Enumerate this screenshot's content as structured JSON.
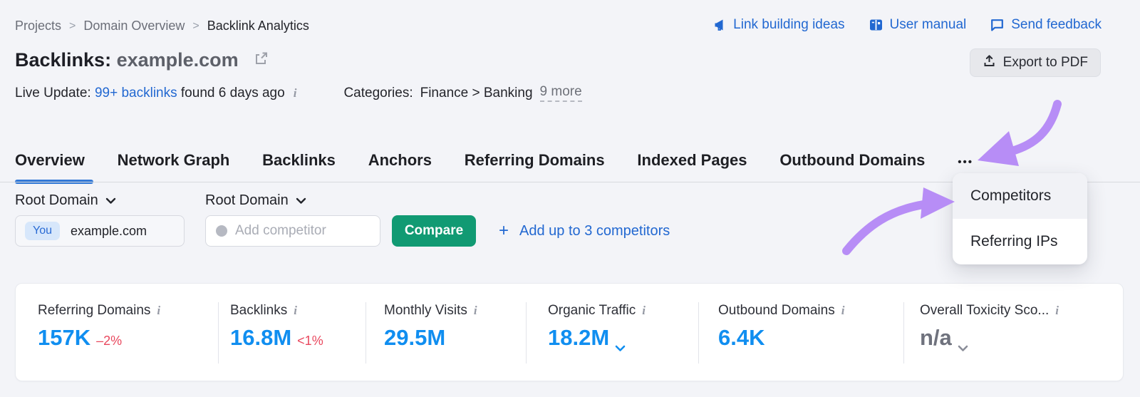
{
  "colors": {
    "page_background": "#f3f4f8",
    "link_blue": "#2268d1",
    "metric_blue": "#108ef0",
    "negative_red": "#e9485e",
    "compare_green": "#119a73",
    "arrow_purple": "#b78df6",
    "active_tab_underline": "#3178d6"
  },
  "breadcrumb": {
    "items": [
      "Projects",
      "Domain Overview",
      "Backlink Analytics"
    ],
    "separator": ">"
  },
  "header_links": {
    "link_building": "Link building ideas",
    "user_manual": "User manual",
    "send_feedback": "Send feedback"
  },
  "title": {
    "prefix": "Backlinks:",
    "domain": "example.com"
  },
  "export_button": {
    "label": "Export to PDF"
  },
  "meta": {
    "live_update_label": "Live Update:",
    "live_update_link": "99+ backlinks",
    "live_update_suffix": "found 6 days ago",
    "info_icon_glyph": "i",
    "categories_label": "Categories:",
    "categories_value": "Finance > Banking",
    "categories_more": "9 more"
  },
  "tabs": {
    "items": [
      {
        "label": "Overview",
        "active": true
      },
      {
        "label": "Network Graph",
        "active": false
      },
      {
        "label": "Backlinks",
        "active": false
      },
      {
        "label": "Anchors",
        "active": false
      },
      {
        "label": "Referring Domains",
        "active": false
      },
      {
        "label": "Indexed Pages",
        "active": false
      },
      {
        "label": "Outbound Domains",
        "active": false
      }
    ],
    "overflow": "•••"
  },
  "overflow_menu": {
    "items": [
      {
        "label": "Competitors",
        "highlighted": true
      },
      {
        "label": "Referring IPs",
        "highlighted": false
      }
    ]
  },
  "filters": {
    "main_label": "Root Domain",
    "competitor_label": "Root Domain"
  },
  "compare_bar": {
    "you_badge": "You",
    "you_domain": "example.com",
    "competitor_placeholder": "Add competitor",
    "compare_label": "Compare",
    "plus": "+",
    "add_competitors_link": "Add up to 3 competitors"
  },
  "metrics": {
    "cards": [
      {
        "label": "Referring Domains",
        "value": "157K",
        "delta": "–2%"
      },
      {
        "label": "Backlinks",
        "value": "16.8M",
        "delta": "<1%"
      },
      {
        "label": "Monthly Visits",
        "value": "29.5M",
        "delta": ""
      },
      {
        "label": "Organic Traffic",
        "value": "18.2M",
        "delta": ""
      },
      {
        "label": "Outbound Domains",
        "value": "6.4K",
        "delta": ""
      },
      {
        "label": "Overall Toxicity Sco...",
        "value": "n/a",
        "delta": ""
      }
    ]
  }
}
